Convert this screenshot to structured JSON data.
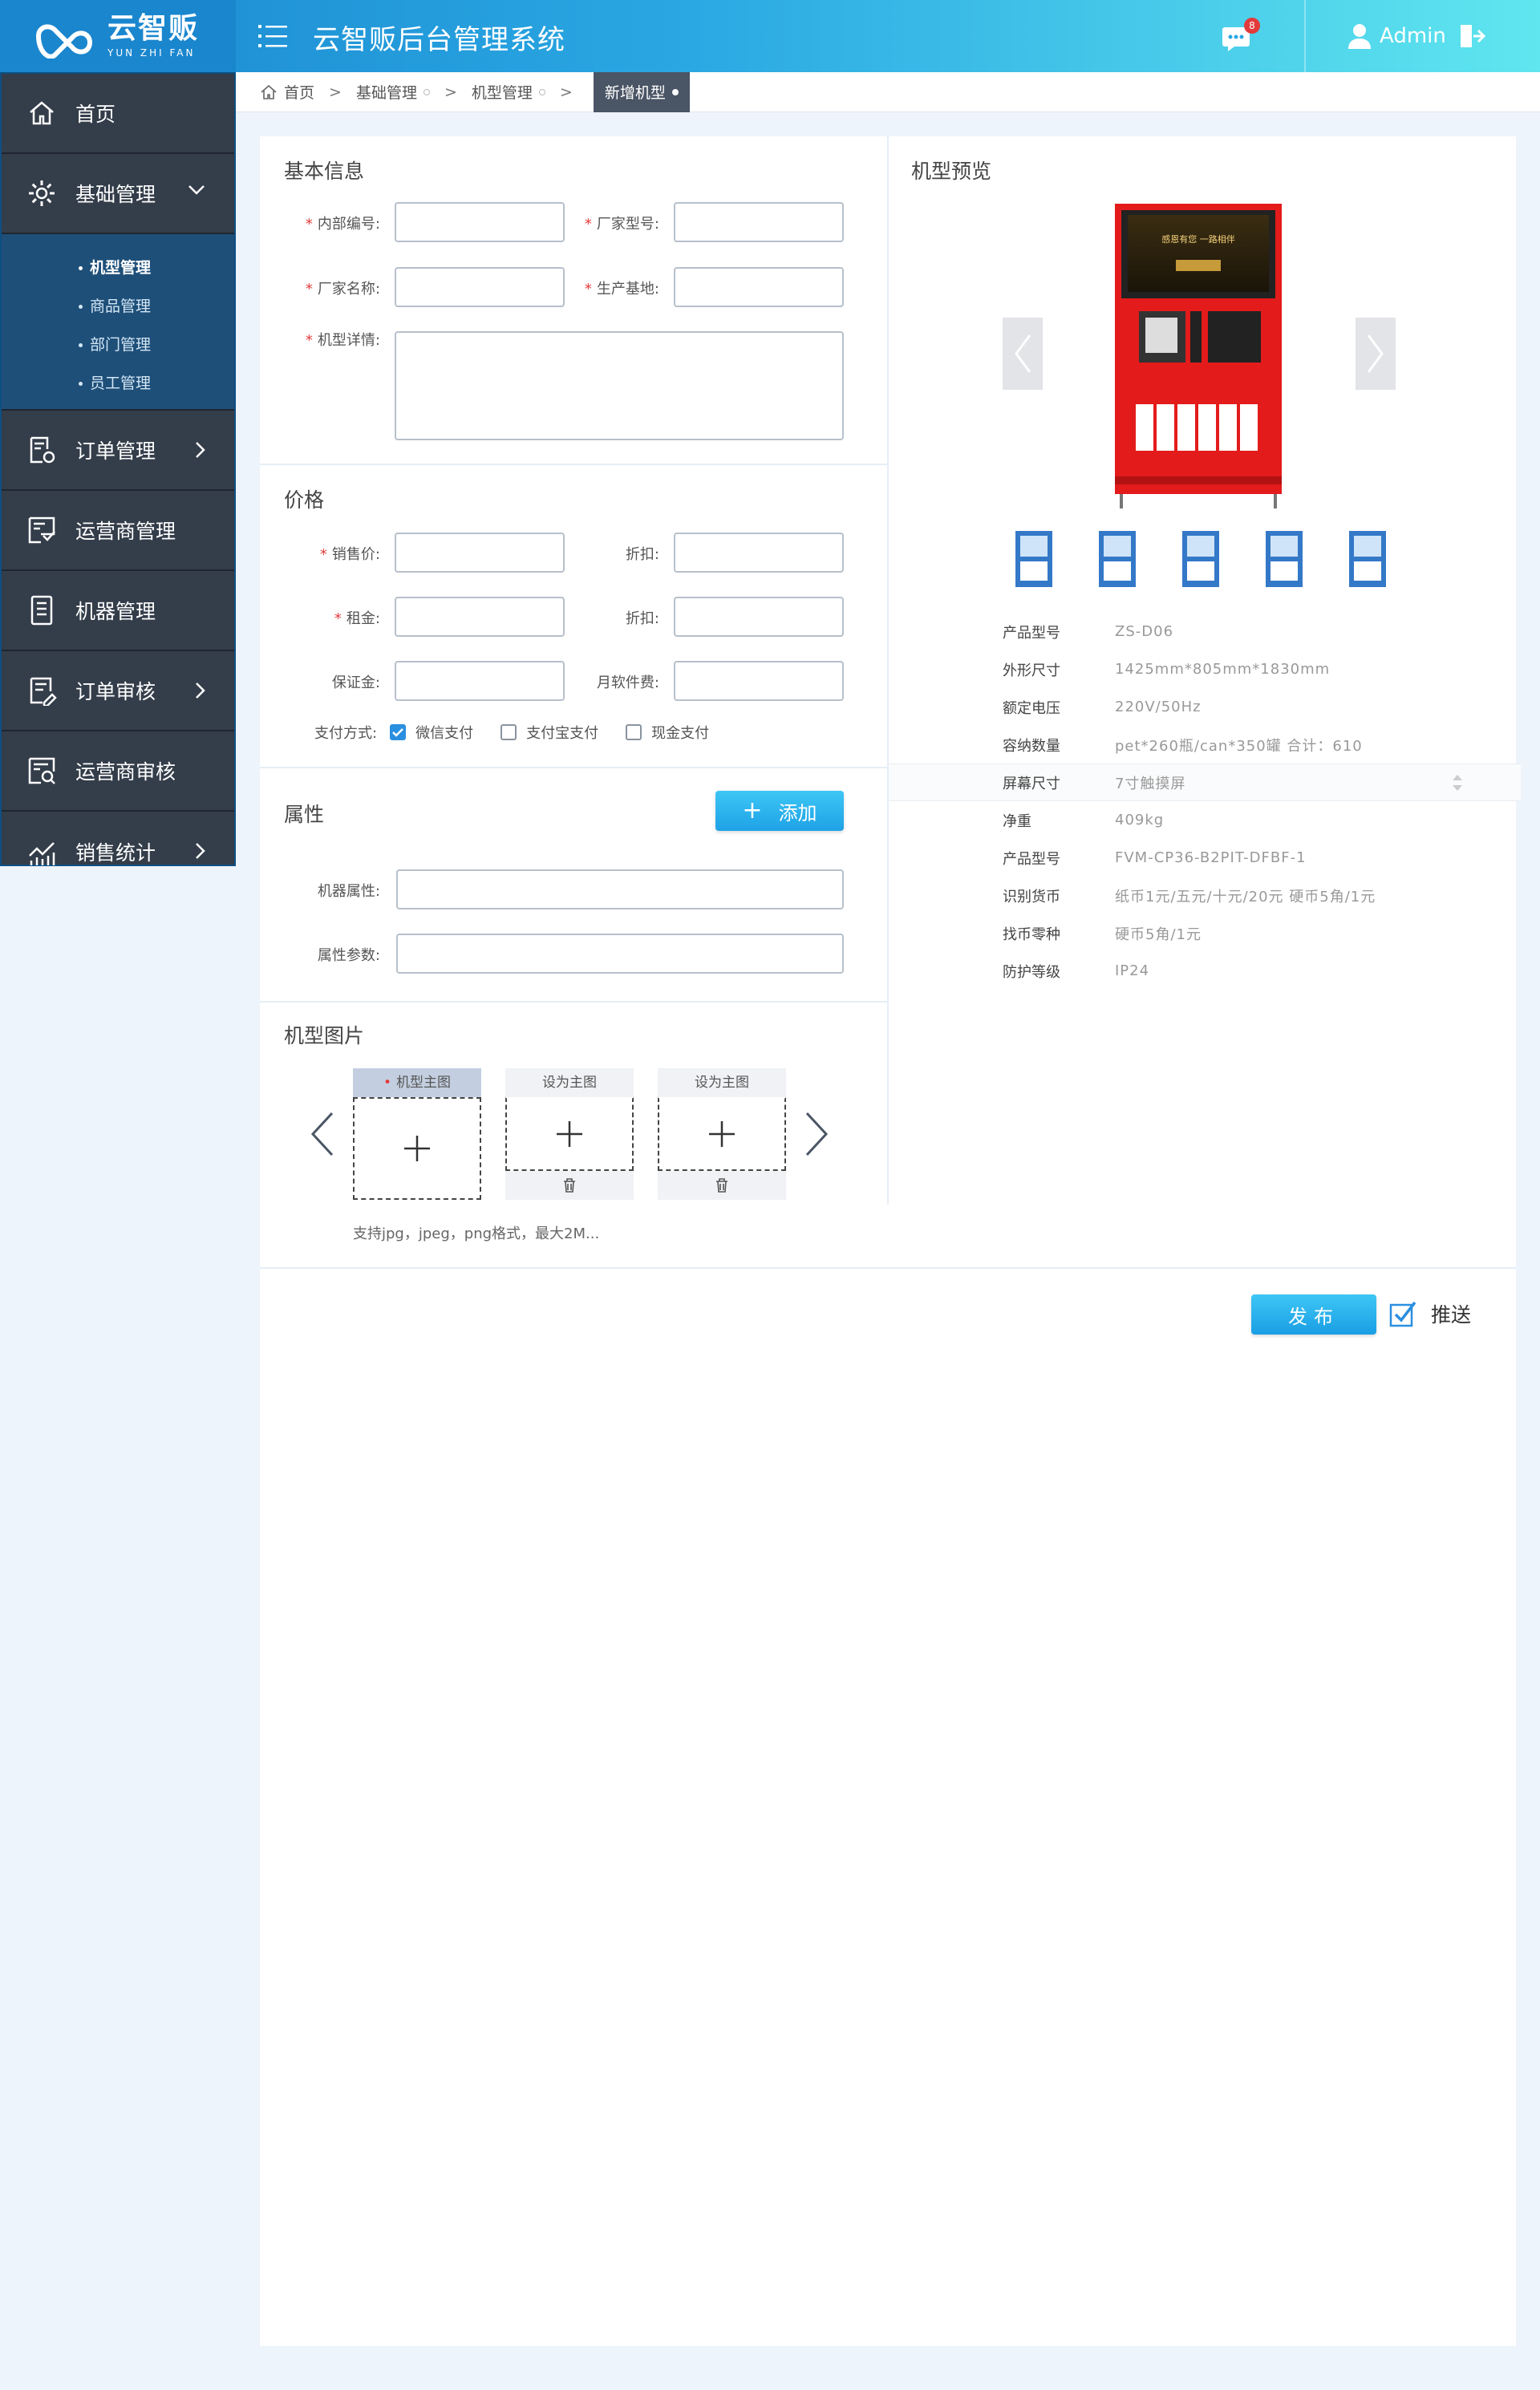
{
  "brand": {
    "name_cn": "云智贩",
    "name_en": "YUN ZHI FAN"
  },
  "header": {
    "title": "云智贩后台管理系统",
    "message_count": "8",
    "username": "Admin"
  },
  "sidebar": {
    "items": [
      {
        "label": "首页"
      },
      {
        "label": "基础管理"
      },
      {
        "label": "订单管理"
      },
      {
        "label": "运营商管理"
      },
      {
        "label": "机器管理"
      },
      {
        "label": "订单审核"
      },
      {
        "label": "运营商审核"
      },
      {
        "label": "销售统计"
      }
    ],
    "sub_items": [
      {
        "label": "机型管理"
      },
      {
        "label": "商品管理"
      },
      {
        "label": "部门管理"
      },
      {
        "label": "员工管理"
      }
    ]
  },
  "breadcrumb": [
    "首页",
    "基础管理",
    "机型管理",
    "新增机型"
  ],
  "basic": {
    "title": "基本信息",
    "internal_no": "内部编号:",
    "maker_model": "厂家型号:",
    "maker_name": "厂家名称:",
    "base": "生产基地:",
    "detail": "机型详情:"
  },
  "price": {
    "title": "价格",
    "sale_price": "销售价:",
    "discount1": "折扣:",
    "rent": "租金:",
    "discount2": "折扣:",
    "deposit": "保证金:",
    "monthly_fee": "月软件费:",
    "pay_label": "支付方式:",
    "pay_options": [
      {
        "label": "微信支付",
        "checked": true
      },
      {
        "label": "支付宝支付",
        "checked": false
      },
      {
        "label": "现金支付",
        "checked": false
      }
    ]
  },
  "attrs": {
    "title": "属性",
    "add_label": "添加",
    "machine_attr": "机器属性:",
    "attr_param": "属性参数:"
  },
  "images": {
    "title": "机型图片",
    "main_label": "机型主图",
    "set_main_label": "设为主图",
    "hint": "支持jpg，jpeg，png格式，最大2M..."
  },
  "preview": {
    "title": "机型预览",
    "screen_text": "感恩有您  一路相伴",
    "specs": [
      {
        "k": "产品型号",
        "v": "ZS-D06"
      },
      {
        "k": "外形尺寸",
        "v": "1425mm*805mm*1830mm"
      },
      {
        "k": "额定电压",
        "v": "220V/50Hz"
      },
      {
        "k": "容纳数量",
        "v": "pet*260瓶/can*350罐 合计：610"
      },
      {
        "k": "屏幕尺寸",
        "v": "7寸触摸屏"
      },
      {
        "k": "净重",
        "v": "409kg"
      },
      {
        "k": "产品型号",
        "v": "FVM-CP36-B2PIT-DFBF-1"
      },
      {
        "k": "识别货币",
        "v": "纸币1元/五元/十元/20元 硬币5角/1元"
      },
      {
        "k": "找币零种",
        "v": "硬币5角/1元"
      },
      {
        "k": "防护等级",
        "v": "IP24"
      }
    ]
  },
  "actions": {
    "publish": "发布",
    "push": "推送"
  },
  "colors": {
    "accent": "#1ea2e6",
    "sidebar_bg": "#343d4a",
    "required": "#e23b3b"
  }
}
